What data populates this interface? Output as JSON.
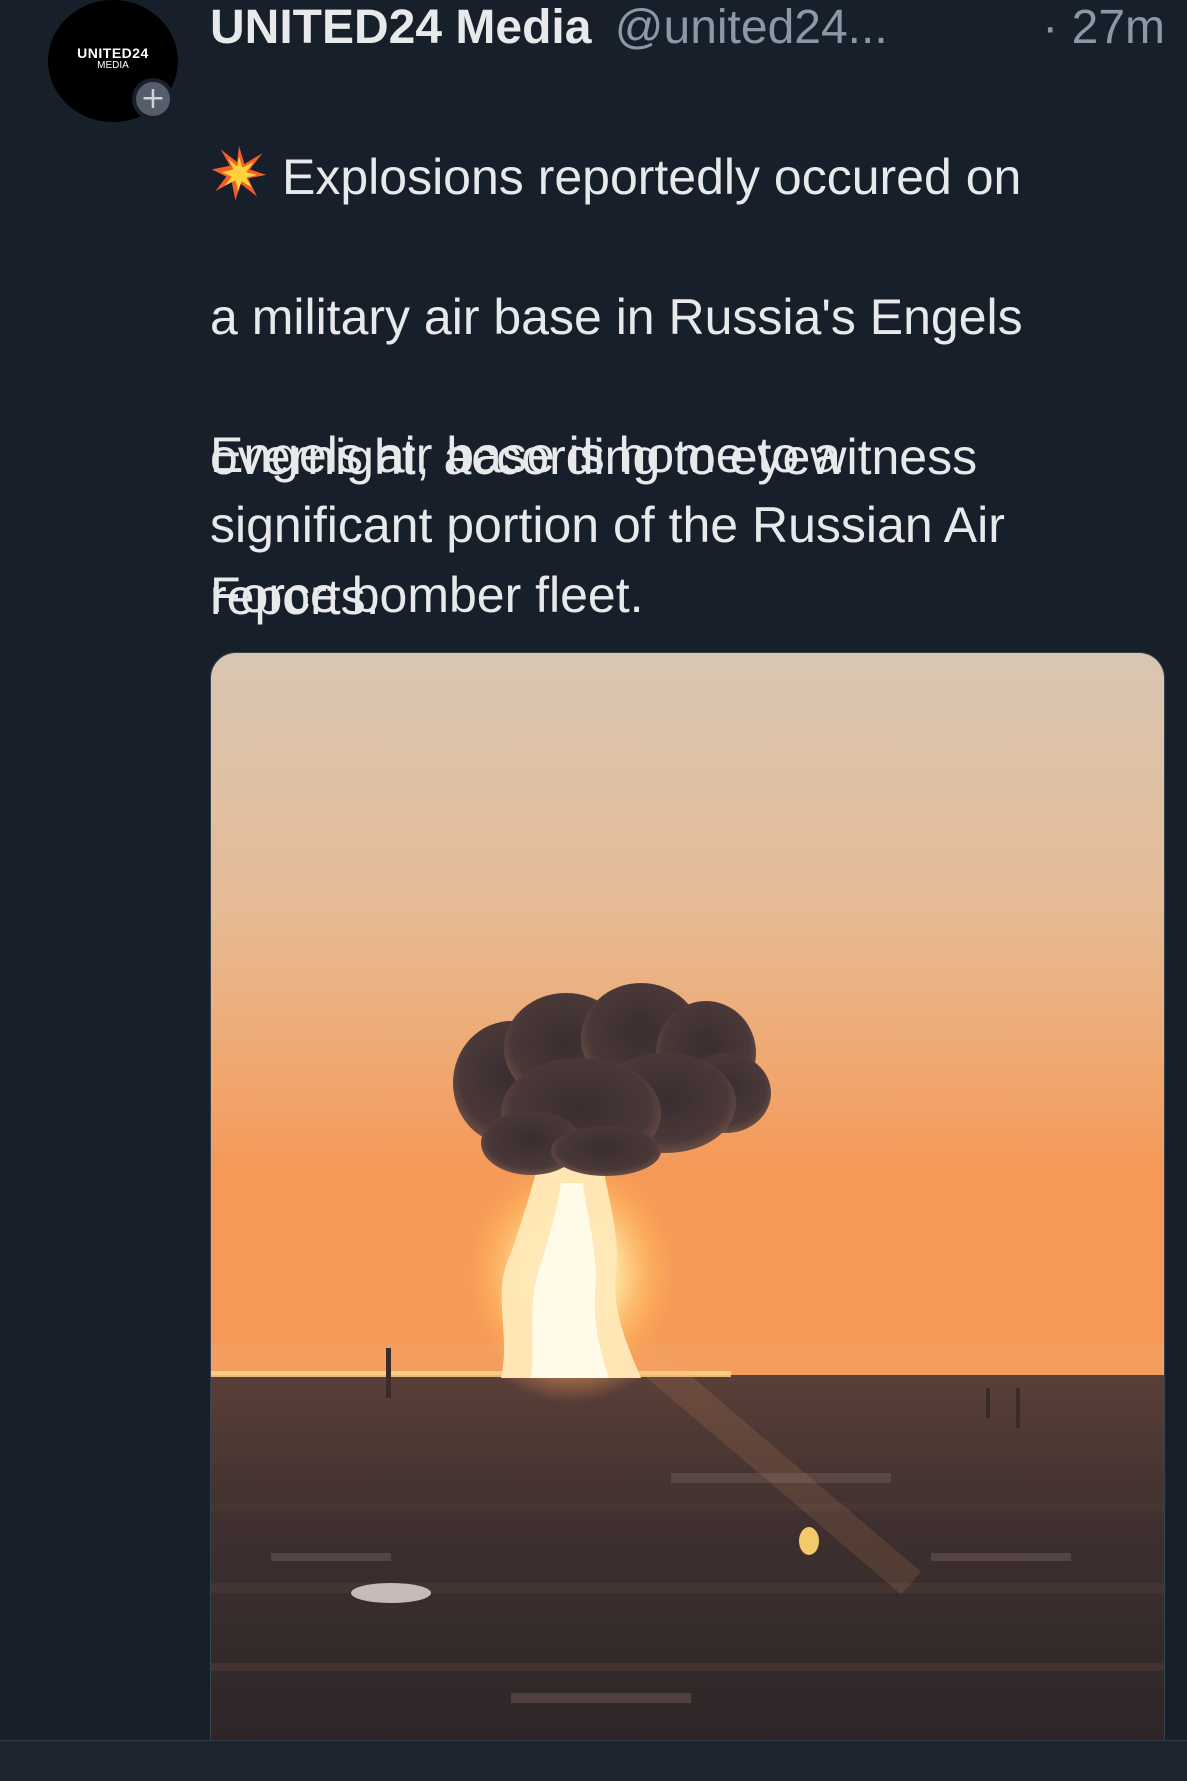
{
  "avatar": {
    "logo_line1": "UNITED24",
    "logo_line2": "MEDIA",
    "follow_symbol": "+",
    "icon": "plus-icon"
  },
  "tweet": {
    "display_name": "UNITED24 Media",
    "handle": "@united24...",
    "separator": "·",
    "time": "27m",
    "emoji_icon": "collision-icon",
    "line1": "Explosions reportedly occured on",
    "line2": "a military air base in Russia's Engels",
    "line3": "overnight, according to eyewitness",
    "line4": "reports.",
    "para2_line1": "Engels air base is home to a",
    "para2_line2": "significant portion of the Russian Air",
    "para2_line3": "Force bomber fleet."
  },
  "media": {
    "type": "photo"
  },
  "colors": {
    "background": "#171f2a",
    "text": "#e7e9ea",
    "secondary_text": "#8b98a5",
    "sky_top": "#d9c2aa",
    "sky_horizon": "#f4a463",
    "ground": "#3c2f2f"
  }
}
